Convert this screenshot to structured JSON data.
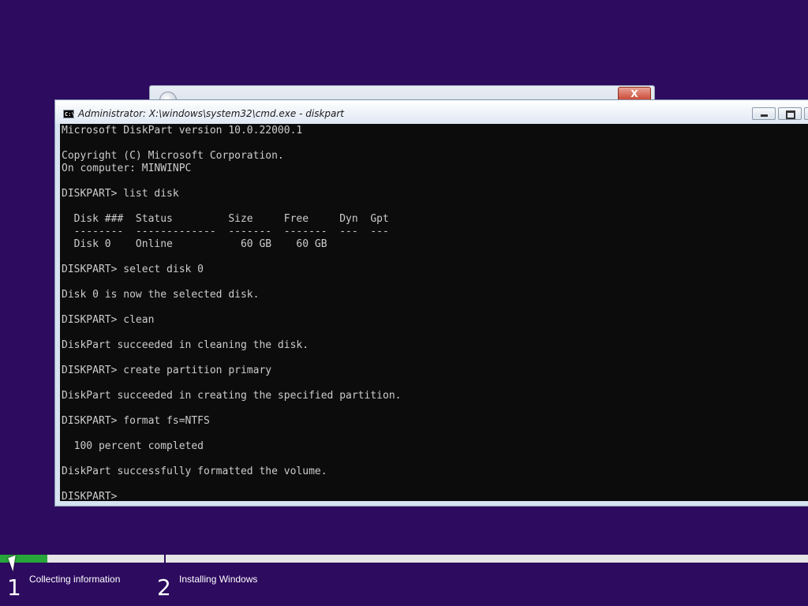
{
  "cmd_window": {
    "title": "Administrator: X:\\windows\\system32\\cmd.exe - diskpart",
    "icon_label": "C:\\."
  },
  "console": {
    "lines": [
      "Microsoft DiskPart version 10.0.22000.1",
      "",
      "Copyright (C) Microsoft Corporation.",
      "On computer: MINWINPC",
      "",
      "DISKPART> list disk",
      "",
      "  Disk ###  Status         Size     Free     Dyn  Gpt",
      "  --------  -------------  -------  -------  ---  ---",
      "  Disk 0    Online           60 GB    60 GB",
      "",
      "DISKPART> select disk 0",
      "",
      "Disk 0 is now the selected disk.",
      "",
      "DISKPART> clean",
      "",
      "DiskPart succeeded in cleaning the disk.",
      "",
      "DISKPART> create partition primary",
      "",
      "DiskPart succeeded in creating the specified partition.",
      "",
      "DISKPART> format fs=NTFS",
      "",
      "  100 percent completed",
      "",
      "DiskPart successfully formatted the volume.",
      "",
      "DISKPART> "
    ]
  },
  "setup_window": {
    "close_label": "X"
  },
  "progress": {
    "step1_fraction": 0.29,
    "accent_color": "#27a63a",
    "steps": [
      {
        "number": "1",
        "label": "Collecting information"
      },
      {
        "number": "2",
        "label": "Installing Windows"
      }
    ]
  },
  "colors": {
    "desktop_background": "#2d0b5f",
    "console_background": "#0c0c0c",
    "console_text": "#cccccc"
  }
}
